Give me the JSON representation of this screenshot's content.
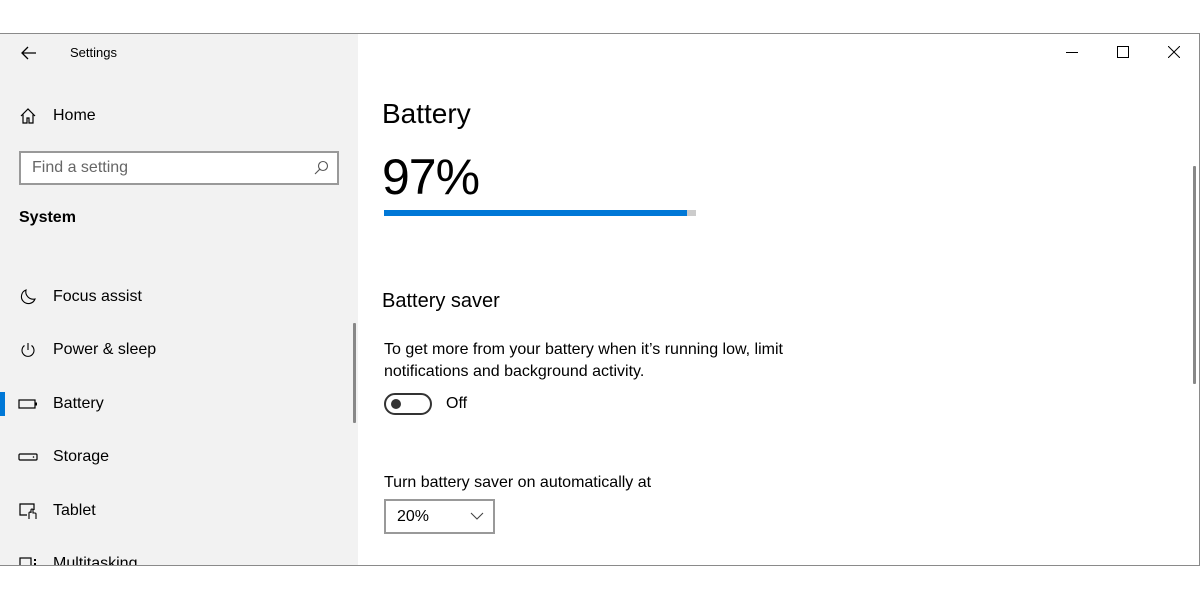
{
  "window": {
    "title": "Settings",
    "controls": {
      "minimize_icon": "minimize-icon",
      "maximize_icon": "maximize-icon",
      "close_icon": "close-icon"
    }
  },
  "sidebar": {
    "back_icon": "back-arrow-icon",
    "home": {
      "label": "Home",
      "icon": "home-icon"
    },
    "search": {
      "placeholder": "Find a setting",
      "value": "",
      "icon": "search-icon"
    },
    "section_title": "System",
    "items": [
      {
        "label": "Focus assist",
        "icon": "moon-icon",
        "active": false
      },
      {
        "label": "Power & sleep",
        "icon": "power-icon",
        "active": false
      },
      {
        "label": "Battery",
        "icon": "battery-icon",
        "active": true
      },
      {
        "label": "Storage",
        "icon": "storage-icon",
        "active": false
      },
      {
        "label": "Tablet",
        "icon": "tablet-icon",
        "active": false
      },
      {
        "label": "Multitasking",
        "icon": "multitasking-icon",
        "active": false
      }
    ]
  },
  "main": {
    "title": "Battery",
    "percentage_text": "97%",
    "battery_level": 0.97,
    "accent_color": "#0078d7",
    "battery_saver": {
      "title": "Battery saver",
      "description": "To get more from your battery when it’s running low, limit notifications and background activity.",
      "toggle_state": "Off",
      "toggle_on": false,
      "auto_label": "Turn battery saver on automatically at",
      "auto_value": "20%"
    }
  }
}
